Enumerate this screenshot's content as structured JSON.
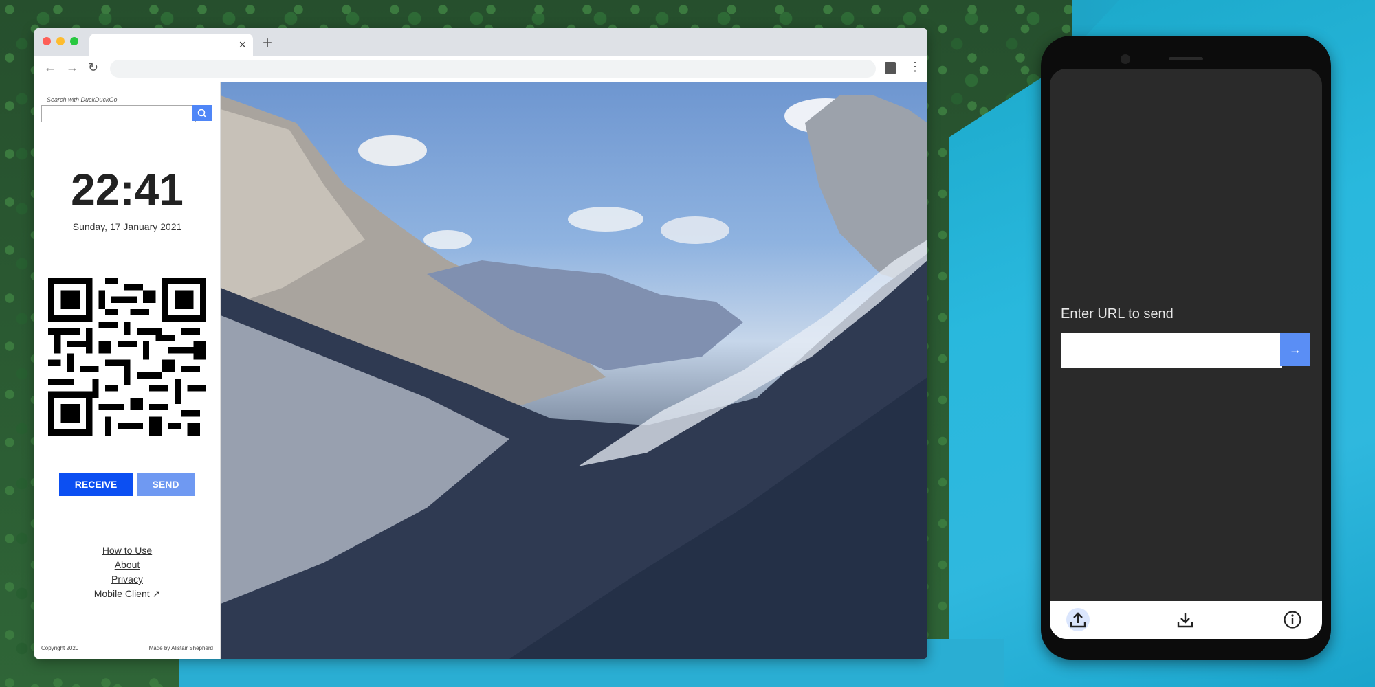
{
  "sidebar": {
    "search_label": "Search with DuckDuckGo",
    "clock": "22:41",
    "date": "Sunday, 17 January 2021",
    "buttons": {
      "receive": "RECEIVE",
      "send": "SEND"
    },
    "links": [
      "How to Use",
      "About",
      "Privacy",
      "Mobile Client"
    ],
    "footer_left": "Copyright 2020",
    "footer_right_prefix": "Made by",
    "footer_author": "Alistair Shepherd"
  },
  "phone": {
    "prompt": "Enter URL to send",
    "go_icon": "arrow-right-icon"
  },
  "icons": {
    "tab_close": "×",
    "new_tab": "+",
    "back": "←",
    "forward": "→",
    "reload": "↻",
    "kebab": "⋮",
    "arrow": "→",
    "external": "↗"
  },
  "colors": {
    "accent": "#0c4ff2",
    "accent_light": "#6f99f2",
    "phone_button": "#5a8ef5"
  }
}
